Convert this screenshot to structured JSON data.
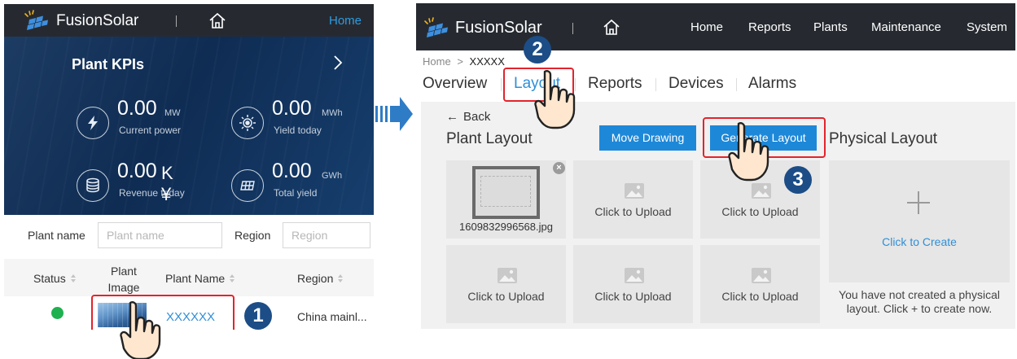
{
  "mobile": {
    "brand": "FusionSolar",
    "home_link": "Home",
    "kpi_title": "Plant KPIs",
    "kpis": [
      {
        "value": "0.00",
        "unit": "MW",
        "label": "Current power",
        "icon": "lightning-icon"
      },
      {
        "value": "0.00",
        "unit": "MWh",
        "label": "Yield today",
        "icon": "sun-icon"
      },
      {
        "value": "0.00",
        "unit": "K ¥",
        "label": "Revenue today",
        "icon": "coins-icon"
      },
      {
        "value": "0.00",
        "unit": "GWh",
        "label": "Total yield",
        "icon": "solar-panel-icon"
      }
    ],
    "filters": {
      "plant_name_label": "Plant name",
      "plant_name_placeholder": "Plant name",
      "region_label": "Region",
      "region_placeholder": "Region"
    },
    "table": {
      "headers": [
        "Status",
        "Plant Image",
        "Plant Name",
        "Region"
      ],
      "rows": [
        {
          "status": "online",
          "plant_name": "XXXXXX",
          "region": "China mainl..."
        }
      ]
    },
    "step_badge": "1"
  },
  "web": {
    "brand": "FusionSolar",
    "nav": [
      "Home",
      "Reports",
      "Plants",
      "Maintenance",
      "System"
    ],
    "breadcrumb": {
      "home": "Home",
      "sep": ">",
      "current": "XXXXX"
    },
    "tabs": [
      "Overview",
      "Layout",
      "Reports",
      "Devices",
      "Alarms"
    ],
    "active_tab": "Layout",
    "back_label": "Back",
    "plant_layout_title": "Plant Layout",
    "move_drawing_button": "Move Drawing",
    "generate_layout_button": "Generate Layout",
    "physical_layout_title": "Physical Layout",
    "uploaded_file": "1609832996568.jpg",
    "upload_tile_label": "Click to Upload",
    "create_link": "Click to Create",
    "physical_note_line1": "You have not created a physical",
    "physical_note_line2": "layout. Click + to create now.",
    "step_badges": [
      "2",
      "3"
    ]
  },
  "colors": {
    "topbar": "#262a30",
    "accent_blue": "#1e88d8",
    "link_blue": "#2f8fd8",
    "highlight_red": "#e3232c",
    "badge_navy": "#1c4d86",
    "status_green": "#1fb050"
  }
}
